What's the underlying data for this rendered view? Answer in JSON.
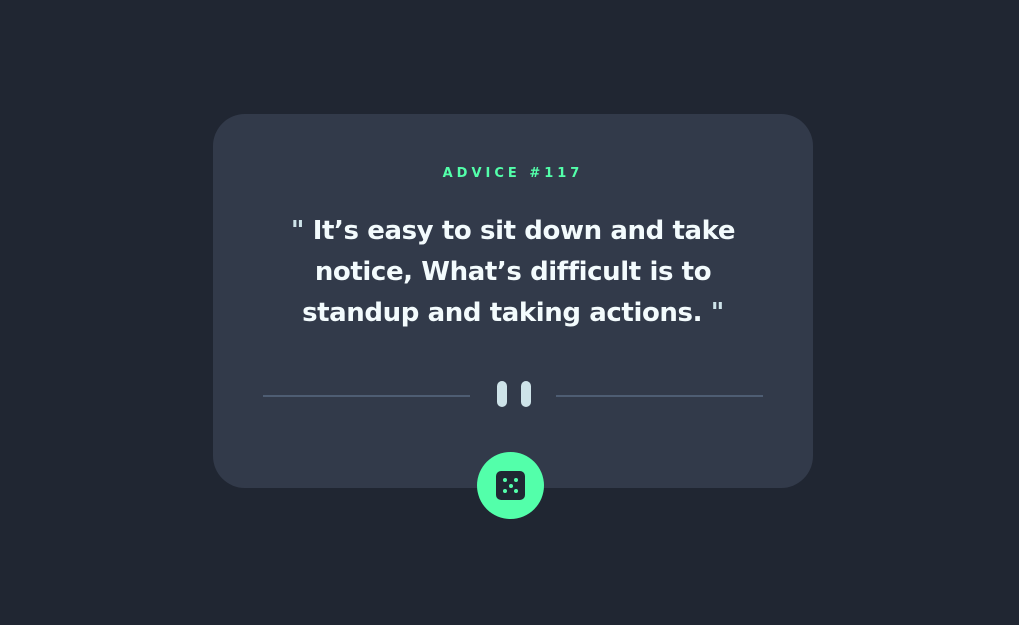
{
  "advice": {
    "label": "ADVICE #117",
    "quote_open": "\"",
    "quote_text": "It’s easy to sit down and take notice, What’s difficult is to standup and taking actions.",
    "quote_close": "\""
  },
  "divider": {
    "icon": "pause-icon"
  },
  "dice_button": {
    "icon": "dice-icon"
  },
  "colors": {
    "background": "#202632",
    "card": "#323A4A",
    "accent": "#53FFAA",
    "text": "#CEE3E9",
    "divider": "#4E5D73"
  }
}
